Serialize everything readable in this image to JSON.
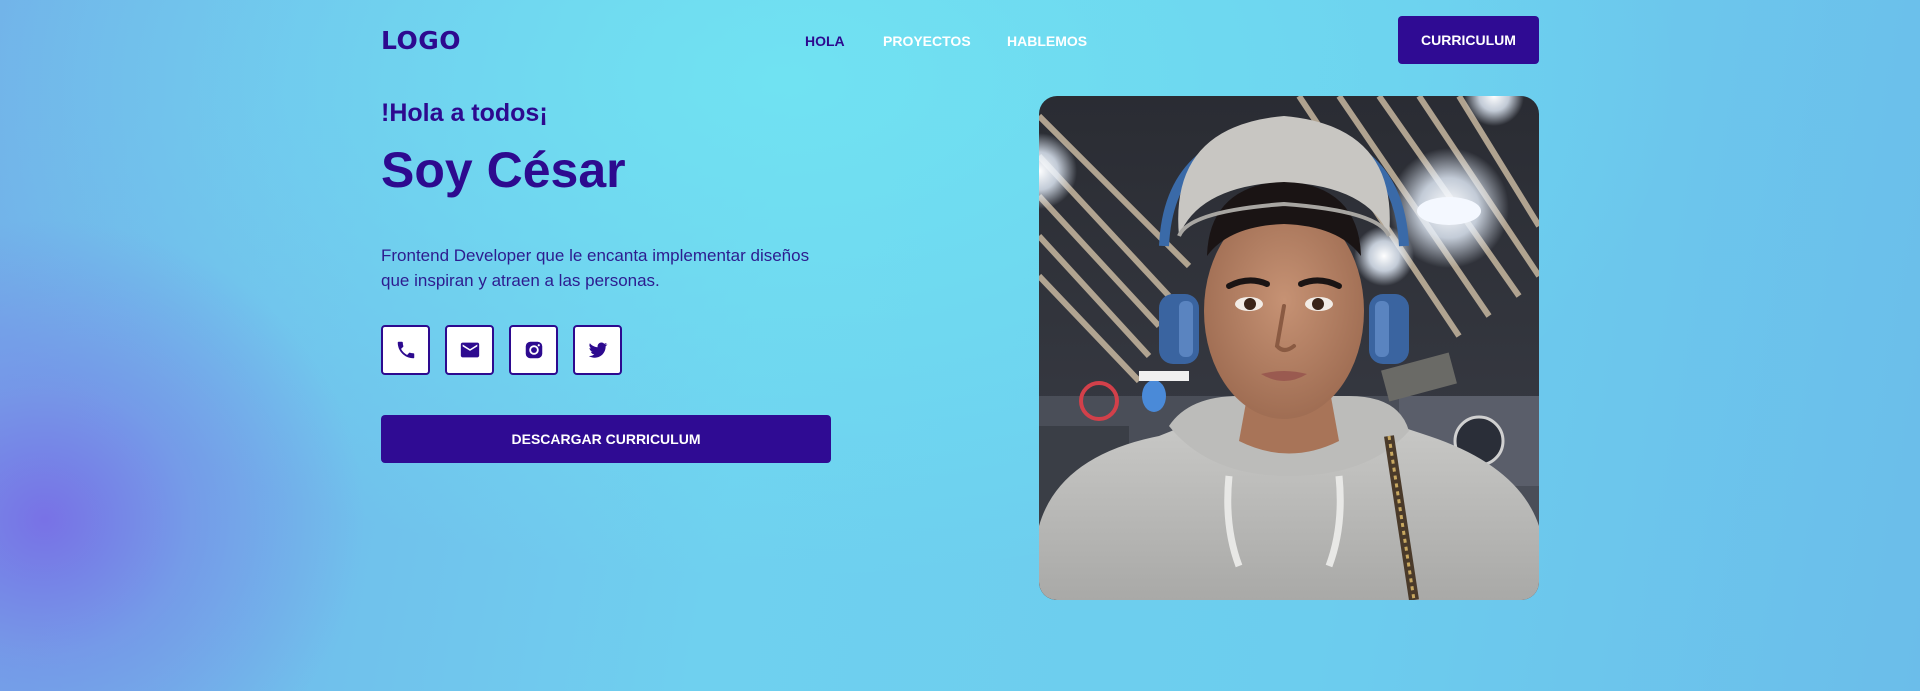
{
  "header": {
    "logo": "LOGO",
    "nav": [
      {
        "label": "HOLA",
        "active": true
      },
      {
        "label": "PROYECTOS",
        "active": false
      },
      {
        "label": "HABLEMOS",
        "active": false
      }
    ],
    "cv_button": "CURRICULUM"
  },
  "hero": {
    "greeting": "!Hola a todos¡",
    "title": "Soy César",
    "description": "Frontend Developer que le encanta implementar diseños que inspiran y atraen a las personas.",
    "socials": [
      {
        "icon": "phone-icon"
      },
      {
        "icon": "mail-icon"
      },
      {
        "icon": "instagram-icon"
      },
      {
        "icon": "twitter-icon"
      }
    ],
    "download_button": "DESCARGAR CURRICULUM",
    "photo": {
      "icon": "profile-photo"
    }
  },
  "colors": {
    "primary": "#2f0b93",
    "text_dark": "#2d0a8f",
    "background_cyan": "#6fd0ef",
    "background_purple": "#7a79e6"
  }
}
